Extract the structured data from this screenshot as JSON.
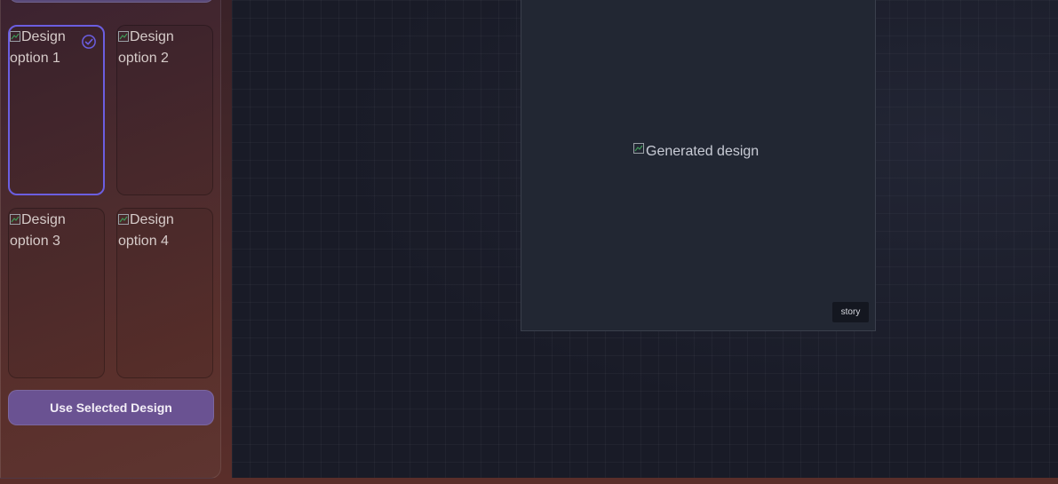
{
  "sidebar": {
    "options": [
      {
        "alt": "Design option 1",
        "selected": true
      },
      {
        "alt": "Design option 2",
        "selected": false
      },
      {
        "alt": "Design option 3",
        "selected": false
      },
      {
        "alt": "Design option 4",
        "selected": false
      }
    ],
    "selected_icon": "check-circle-icon",
    "use_button_label": "Use Selected Design"
  },
  "canvas": {
    "image_alt": "Generated design",
    "tag": "story"
  },
  "colors": {
    "accent": "#6b5ee0",
    "button": "#6a5292",
    "canvas_bg": "#191b27",
    "card_bg": "#222733"
  }
}
